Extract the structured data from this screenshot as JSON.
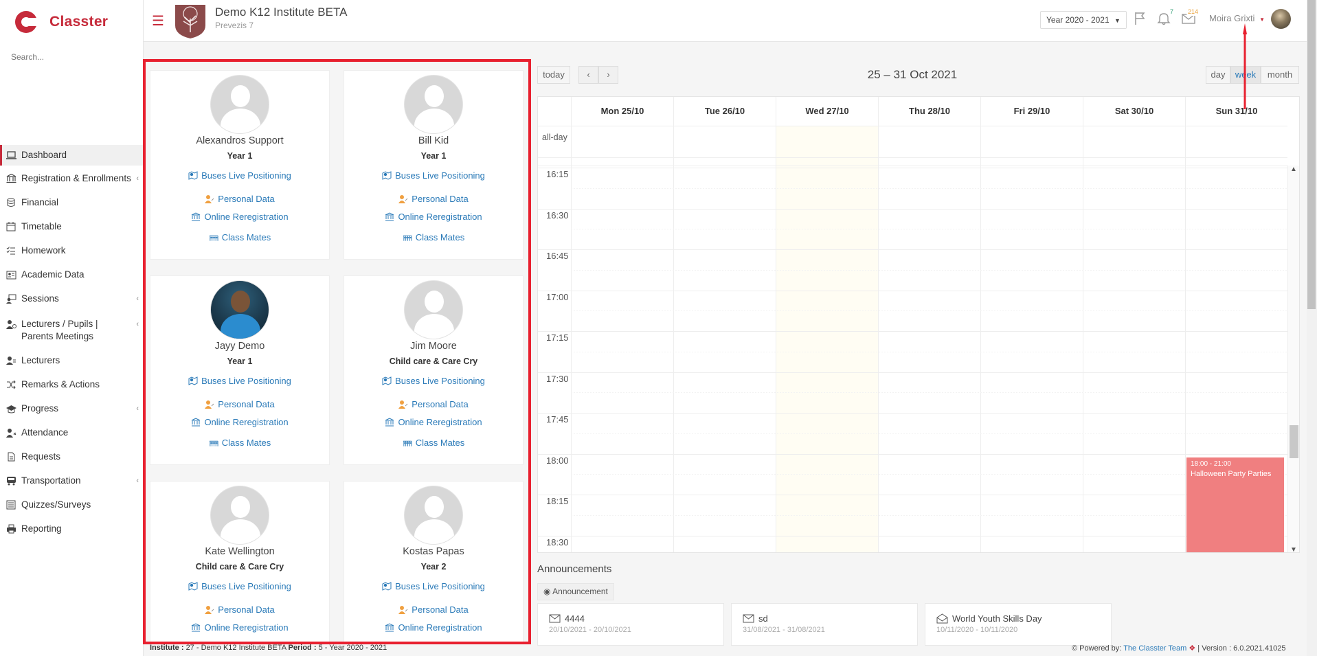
{
  "app": {
    "name": "Classter",
    "brand_color": "#c62a3a",
    "highlight_color": "#e8202f"
  },
  "search": {
    "placeholder": "Search..."
  },
  "sidebar": {
    "items": [
      {
        "label": "Dashboard",
        "icon": "laptop-icon",
        "active": true
      },
      {
        "label": "Registration & Enrollments",
        "icon": "institution-icon",
        "has_sub": true
      },
      {
        "label": "Financial",
        "icon": "coins-icon"
      },
      {
        "label": "Timetable",
        "icon": "calendar-icon"
      },
      {
        "label": "Homework",
        "icon": "checklist-icon"
      },
      {
        "label": "Academic Data",
        "icon": "id-card-icon"
      },
      {
        "label": "Sessions",
        "icon": "sessions-icon",
        "has_sub": true
      },
      {
        "label": "Lecturers / Pupils | Parents Meetings",
        "icon": "meeting-icon",
        "has_sub": true
      },
      {
        "label": "Lecturers",
        "icon": "users-icon"
      },
      {
        "label": "Remarks & Actions",
        "icon": "shuffle-icon"
      },
      {
        "label": "Progress",
        "icon": "graduation-cap-icon",
        "has_sub": true
      },
      {
        "label": "Attendance",
        "icon": "user-x-icon"
      },
      {
        "label": "Requests",
        "icon": "document-icon"
      },
      {
        "label": "Transportation",
        "icon": "bus-icon",
        "has_sub": true
      },
      {
        "label": "Quizzes/Surveys",
        "icon": "list-icon"
      },
      {
        "label": "Reporting",
        "icon": "printer-icon"
      }
    ]
  },
  "header": {
    "institute_name": "Demo K12 Institute BETA",
    "institute_sub": "Prevezis 7",
    "year_select": "Year 2020 - 2021",
    "notifications_count": "7",
    "messages_count": "214",
    "user_name": "Moira Grixti"
  },
  "students": [
    {
      "name": "Alexandros Support",
      "year": "Year 1",
      "photo": false
    },
    {
      "name": "Bill Kid",
      "year": "Year 1",
      "photo": false
    },
    {
      "name": "Jayy Demo",
      "year": "Year 1",
      "photo": true
    },
    {
      "name": "Jim Moore",
      "year": "Child care & Care Cry",
      "photo": false
    },
    {
      "name": "Kate Wellington",
      "year": "Child care & Care Cry",
      "photo": false
    },
    {
      "name": "Kostas Papas",
      "year": "Year 2",
      "photo": false
    }
  ],
  "student_links": {
    "buses": "Buses Live Positioning",
    "personal": "Personal Data",
    "rereg": "Online Reregistration",
    "classmates": "Class Mates"
  },
  "calendar": {
    "today_label": "today",
    "prev_label": "‹",
    "next_label": "›",
    "range_title": "25 – 31 Oct 2021",
    "view_day": "day",
    "view_week": "week",
    "view_month": "month",
    "allday_label": "all-day",
    "days": [
      "Mon 25/10",
      "Tue 26/10",
      "Wed 27/10",
      "Thu 28/10",
      "Fri 29/10",
      "Sat 30/10",
      "Sun 31/10"
    ],
    "times": [
      "16:15",
      "16:30",
      "16:45",
      "17:00",
      "17:15",
      "17:30",
      "17:45",
      "18:00",
      "18:15",
      "18:30"
    ],
    "event": {
      "time": "18:00 - 21:00",
      "title": "Halloween Party Parties",
      "color": "#f07f80"
    }
  },
  "announcements": {
    "title": "Announcements",
    "tag": "Announcement",
    "items": [
      {
        "title": "4444",
        "dates": "20/10/2021 - 20/10/2021",
        "icon": "envelope-icon"
      },
      {
        "title": "sd",
        "dates": "31/08/2021 - 31/08/2021",
        "icon": "envelope-icon"
      },
      {
        "title": "World Youth Skills Day",
        "dates": "10/11/2020 - 10/11/2020",
        "icon": "envelope-open-icon"
      }
    ]
  },
  "footer": {
    "institute_label": "Institute :",
    "institute_value": "27 - Demo K12 Institute BETA",
    "period_label": "Period :",
    "period_value": "5 - Year 2020 - 2021",
    "powered_label": "Powered by:",
    "powered_link": "The Classter Team",
    "version": "| Version : 6.0.2021.41025"
  }
}
